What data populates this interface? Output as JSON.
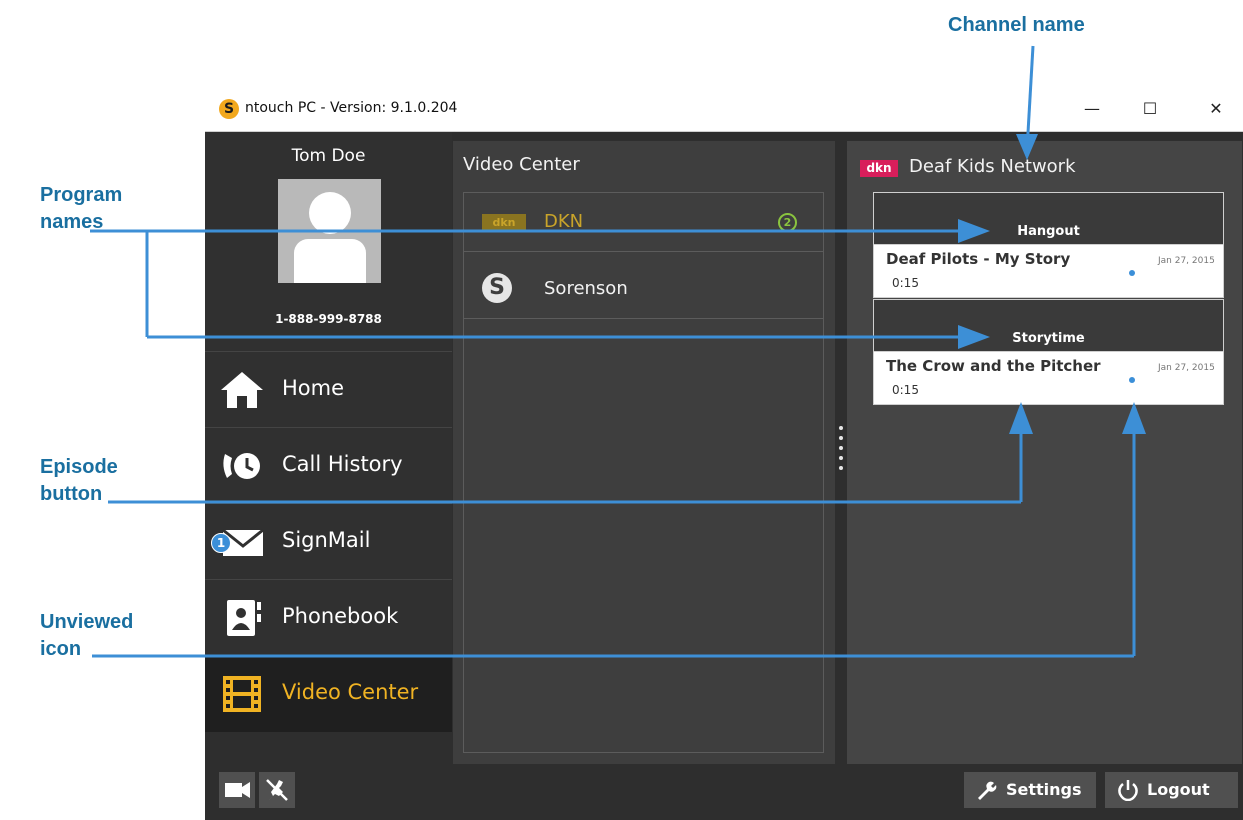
{
  "callouts": {
    "channel_name": "Channel name",
    "program_names": "Program\nnames",
    "episode_button": "Episode\nbutton",
    "unviewed_icon": "Unviewed\nicon"
  },
  "window": {
    "title": "ntouch PC  -  Version:  9.1.0.204",
    "minimize": "—",
    "maximize": "☐",
    "close": "✕"
  },
  "user": {
    "name": "Tom Doe",
    "phone": "1-888-999-8788"
  },
  "nav": {
    "home": "Home",
    "call_history": "Call History",
    "signmail": "SignMail",
    "signmail_badge": "1",
    "phonebook": "Phonebook",
    "video_center": "Video Center"
  },
  "video_center": {
    "title": "Video Center",
    "channels": [
      {
        "label": "DKN",
        "count": "2",
        "icon": "dkn-logo-icon"
      },
      {
        "label": "Sorenson",
        "icon": "sorenson-logo-icon"
      }
    ]
  },
  "channel": {
    "logo": "dkn",
    "title": "Deaf Kids Network",
    "programs": [
      {
        "name": "Hangout",
        "episodes": [
          {
            "title": "Deaf Pilots - My Story",
            "duration": "0:15",
            "date": "Jan 27, 2015",
            "unviewed": true
          }
        ]
      },
      {
        "name": "Storytime",
        "episodes": [
          {
            "title": "The Crow and the Pitcher",
            "duration": "0:15",
            "date": "Jan 27, 2015",
            "unviewed": true
          }
        ]
      }
    ]
  },
  "footer": {
    "settings": "Settings",
    "logout": "Logout"
  },
  "colors": {
    "accent": "#f0b323",
    "callout": "#1a6fa0",
    "arrow": "#3d8fd6"
  }
}
